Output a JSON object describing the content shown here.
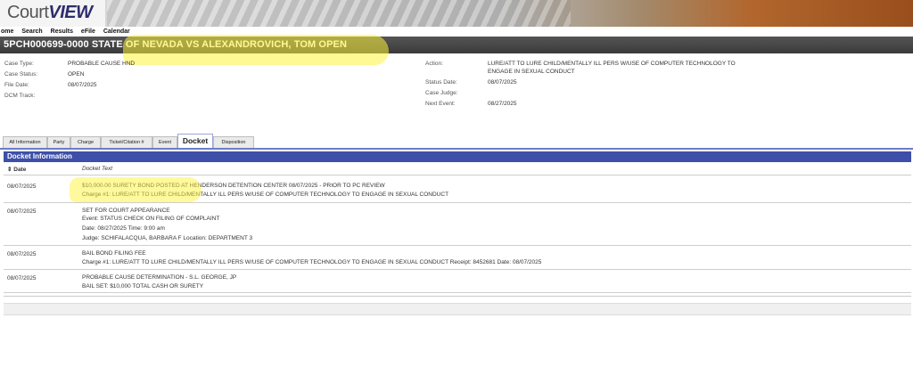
{
  "app": {
    "logo_court": "Court",
    "logo_view": "VIEW"
  },
  "nav": [
    "ome",
    "Search",
    "Results",
    "eFile",
    "Calendar"
  ],
  "case": {
    "title": "5PCH000699-0000 STATE OF NEVADA VS ALEXANDROVICH, TOM OPEN"
  },
  "info": {
    "case_type_label": "Case Type:",
    "case_type": "PROBABLE CAUSE HND",
    "case_status_label": "Case Status:",
    "case_status": "OPEN",
    "file_date_label": "File Date:",
    "file_date": "08/07/2025",
    "dcm_track_label": "DCM Track:",
    "action_label": "Action:",
    "action_line1": "LURE/ATT TO LURE CHILD/MENTALLY ILL PERS W/USE OF COMPUTER TECHNOLOGY TO",
    "action_line2": "ENGAGE IN SEXUAL CONDUCT",
    "status_date_label": "Status Date:",
    "status_date": "08/07/2025",
    "case_judge_label": "Case Judge:",
    "next_event_label": "Next Event:",
    "next_event": "08/27/2025"
  },
  "tabs": [
    "All Information",
    "Party",
    "Charge",
    "Ticket/Citation #",
    "Event",
    "Docket",
    "Disposition"
  ],
  "docket": {
    "header": "Docket Information",
    "col_date": "⇕ Date",
    "col_text": "Docket Text",
    "entries": [
      {
        "date": "08/07/2025",
        "lines": [
          "$10,000.00 SURETY BOND POSTED AT HENDERSON DETENTION CENTER 08/07/2025 - PRIOR TO PC REVIEW",
          "Charge #1: LURE/ATT TO LURE CHILD/MENTALLY ILL PERS W/USE OF COMPUTER TECHNOLOGY TO ENGAGE IN SEXUAL CONDUCT"
        ]
      },
      {
        "date": "08/07/2025",
        "lines": [
          "SET FOR COURT APPEARANCE",
          "Event: STATUS CHECK ON FILING OF COMPLAINT",
          "Date: 08/27/2025   Time: 9:00 am",
          "Judge: SCHIFALACQUA, BARBARA F   Location: DEPARTMENT 3"
        ]
      },
      {
        "date": "08/07/2025",
        "lines": [
          "BAIL BOND FILING FEE",
          "Charge #1: LURE/ATT TO LURE CHILD/MENTALLY ILL PERS W/USE OF COMPUTER TECHNOLOGY TO ENGAGE IN SEXUAL CONDUCT   Receipt: 8452681   Date: 08/07/2025"
        ]
      },
      {
        "date": "08/07/2025",
        "lines": [
          "PROBABLE CAUSE DETERMINATION - S.L. GEORGE, JP",
          "BAIL SET: $10,000 TOTAL CASH OR SURETY"
        ]
      }
    ]
  },
  "colors": {
    "case_bar": "#3a3a3a",
    "docket_header": "#3d4fa8",
    "highlight": "#fff43c"
  }
}
